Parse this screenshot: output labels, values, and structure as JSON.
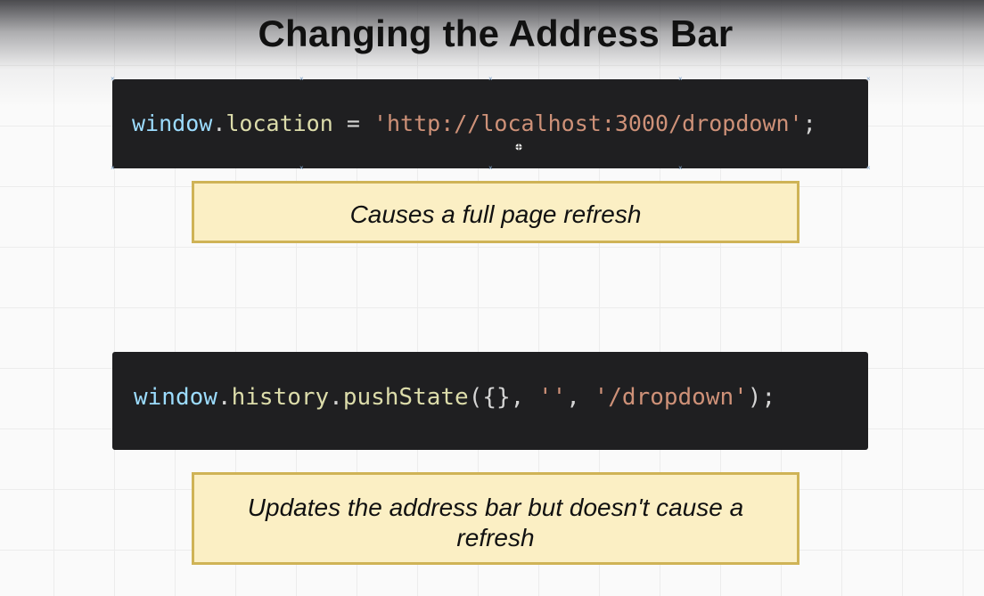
{
  "slide": {
    "title": "Changing the Address Bar"
  },
  "code_blocks": [
    {
      "tokens": [
        {
          "text": "window",
          "kind": "var"
        },
        {
          "text": ".",
          "kind": "punc"
        },
        {
          "text": "location",
          "kind": "prop"
        },
        {
          "text": " = ",
          "kind": "punc"
        },
        {
          "text": "'http://localhost:3000/dropdown'",
          "kind": "str"
        },
        {
          "text": ";",
          "kind": "punc"
        }
      ]
    },
    {
      "tokens": [
        {
          "text": "window",
          "kind": "var"
        },
        {
          "text": ".",
          "kind": "punc"
        },
        {
          "text": "history",
          "kind": "prop"
        },
        {
          "text": ".",
          "kind": "punc"
        },
        {
          "text": "pushState",
          "kind": "prop"
        },
        {
          "text": "({}, ",
          "kind": "punc"
        },
        {
          "text": "''",
          "kind": "str"
        },
        {
          "text": ", ",
          "kind": "punc"
        },
        {
          "text": "'/dropdown'",
          "kind": "str"
        },
        {
          "text": ");",
          "kind": "punc"
        }
      ]
    }
  ],
  "notes": [
    {
      "text": "Causes a full page refresh"
    },
    {
      "text": "Updates the address bar but doesn't cause a refresh"
    }
  ],
  "colors": {
    "code_background": "#1f1f21",
    "note_background": "#fbefc4",
    "note_border": "#cfb356",
    "token_var": "#9cdcfe",
    "token_prop": "#dcdcaa",
    "token_str": "#ce9178"
  }
}
